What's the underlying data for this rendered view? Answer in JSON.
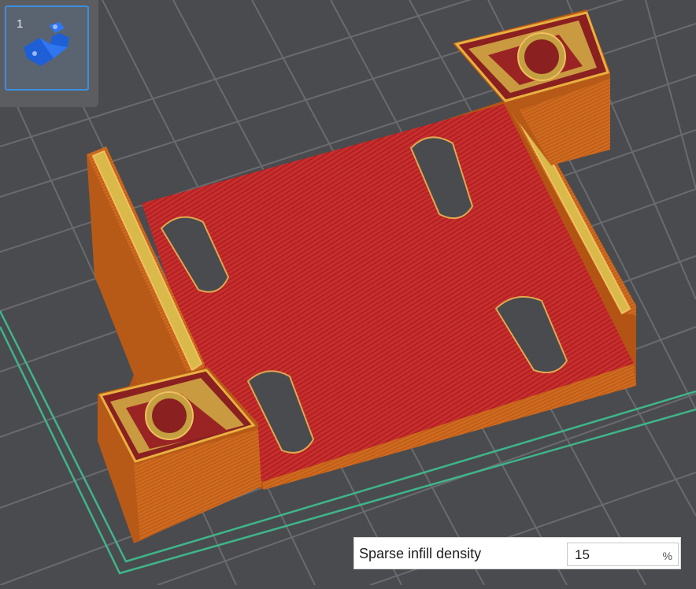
{
  "plate": {
    "number": "1"
  },
  "setting": {
    "label": "Sparse infill density",
    "value": "15",
    "unit": "%"
  }
}
